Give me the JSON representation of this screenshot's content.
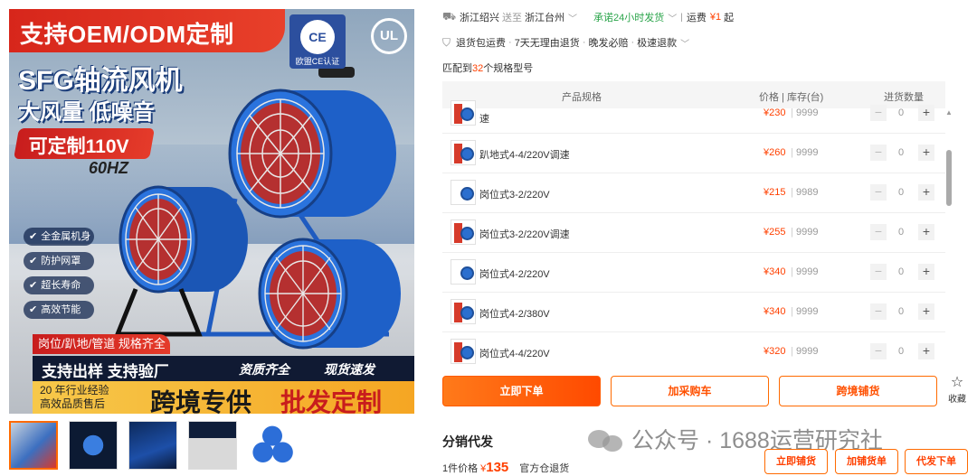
{
  "hero": {
    "banner": "支持OEM/ODM定制",
    "ce_mark": "CE",
    "ce_caption": "欧盟CE认证",
    "ul_mark": "UL",
    "title": "SFG轴流风机",
    "subtitle": "大风量 低噪音",
    "custom_voltage": "可定制110V",
    "frequency": "60HZ",
    "features": [
      "全金属机身",
      "防护网罩",
      "超长寿命",
      "高效节能"
    ],
    "types": "岗位/趴地/管道  规格齐全",
    "support": "支持出样  支持验厂",
    "qualification": "资质齐全",
    "fast_ship": "现货速发",
    "experience_line1": "20 年行业经验",
    "experience_line2": "高效品质售后",
    "slogan_left": "跨境专供",
    "slogan_right": "批发定制"
  },
  "colors": {
    "accent": "#ff5000",
    "price": "#ff4000",
    "green": "#2aa44a"
  },
  "shipping": {
    "from": "浙江绍兴",
    "to_word": "送至",
    "to": "浙江台州",
    "promise": "承诺24小时发货",
    "fee_label": "运费",
    "fee": "¥1",
    "fee_suffix": "起"
  },
  "services": {
    "items": [
      "退货包运费",
      "7天无理由退货",
      "晚发必赔",
      "极速退款"
    ]
  },
  "match": {
    "prefix": "匹配到",
    "count": "32",
    "suffix": "个规格型号"
  },
  "table": {
    "headers": [
      "产品规格",
      "价格 | 库存(台)",
      "进货数量"
    ],
    "rows": [
      {
        "name": "速",
        "price": "¥230",
        "stock": "9999",
        "qty": "0"
      },
      {
        "name": "趴地式4-4/220V调速",
        "price": "¥260",
        "stock": "9999",
        "qty": "0"
      },
      {
        "name": "岗位式3-2/220V",
        "price": "¥215",
        "stock": "9989",
        "qty": "0"
      },
      {
        "name": "岗位式3-2/220V调速",
        "price": "¥255",
        "stock": "9999",
        "qty": "0"
      },
      {
        "name": "岗位式4-2/220V",
        "price": "¥340",
        "stock": "9999",
        "qty": "0"
      },
      {
        "name": "岗位式4-2/380V",
        "price": "¥340",
        "stock": "9999",
        "qty": "0"
      },
      {
        "name": "岗位式4-4/220V",
        "price": "¥320",
        "stock": "9999",
        "qty": "0"
      }
    ],
    "minus": "−",
    "plus": "+"
  },
  "actions": {
    "order": "立即下单",
    "cart": "加采购车",
    "cross": "跨境铺货",
    "favorite": "收藏"
  },
  "distribution": {
    "title": "分销代发",
    "unit_label": "1件价格",
    "currency": "¥",
    "price": "135",
    "return_note": "官方仓退货",
    "btn_store": "立即铺货",
    "btn_supply": "加铺货单",
    "btn_proxy": "代发下单"
  },
  "watermark": "公众号 · 1688运营研究社",
  "icons": {
    "shipping": "truck-icon",
    "service": "shield-check-icon",
    "favorite": "star-icon",
    "chevron": "chevron-down-icon"
  }
}
